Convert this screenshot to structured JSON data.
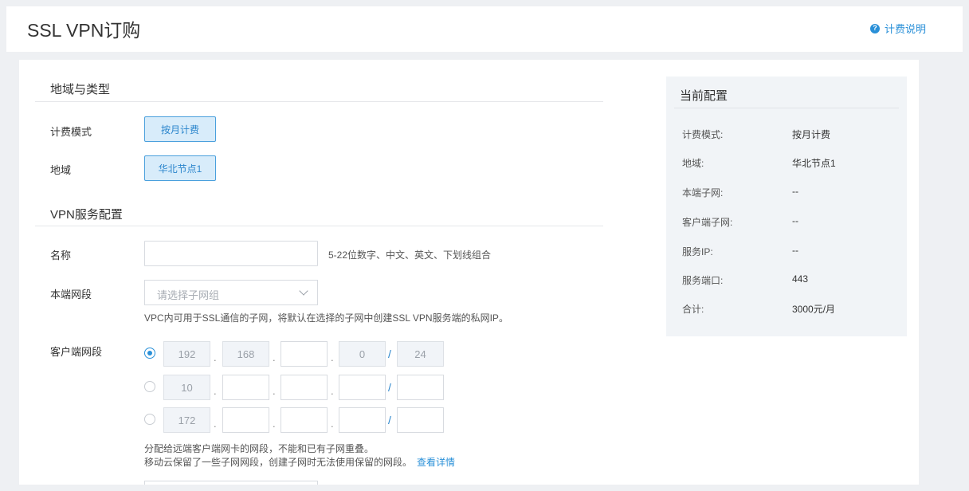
{
  "header": {
    "title": "SSL VPN订购",
    "help_link": "计费说明"
  },
  "form": {
    "section_region": "地域与类型",
    "billing_label": "计费模式",
    "billing_option": "按月计费",
    "region_label": "地域",
    "region_option": "华北节点1",
    "section_vpn": "VPN服务配置",
    "name_label": "名称",
    "name_value": "",
    "name_hint": "5-22位数字、中文、英文、下划线组合",
    "subnet_label": "本端网段",
    "subnet_placeholder": "请选择子网组",
    "subnet_hint": "VPC内可用于SSL通信的子网，将默认在选择的子网中创建SSL VPN服务端的私网IP。",
    "client_label": "客户端网段",
    "client_rows": [
      {
        "selected": true,
        "o1": "192",
        "o2": "168",
        "o3": "",
        "o4": "0",
        "mask": "24"
      },
      {
        "selected": false,
        "o1": "10",
        "o2": "",
        "o3": "",
        "o4": "",
        "mask": ""
      },
      {
        "selected": false,
        "o1": "172",
        "o2": "",
        "o3": "",
        "o4": "",
        "mask": ""
      }
    ],
    "client_hint_1": "分配给远端客户端网卡的网段，不能和已有子网重叠。",
    "client_hint_2": "移动云保留了一些子网网段，创建子网时无法使用保留的网段。",
    "client_hint_link": "查看详情"
  },
  "summary": {
    "title": "当前配置",
    "rows": [
      {
        "label": "计费模式:",
        "value": "按月计费"
      },
      {
        "label": "地域:",
        "value": "华北节点1"
      },
      {
        "label": "本端子网:",
        "value": "--"
      },
      {
        "label": "客户端子网:",
        "value": "--"
      },
      {
        "label": "服务IP:",
        "value": "--"
      },
      {
        "label": "服务端口:",
        "value": "443"
      },
      {
        "label": "合计:",
        "value": "3000元/月"
      }
    ]
  },
  "colors": {
    "accent": "#2a90d8",
    "selected_bg": "#d8ecfa",
    "panel_bg": "#f1f4f7"
  }
}
